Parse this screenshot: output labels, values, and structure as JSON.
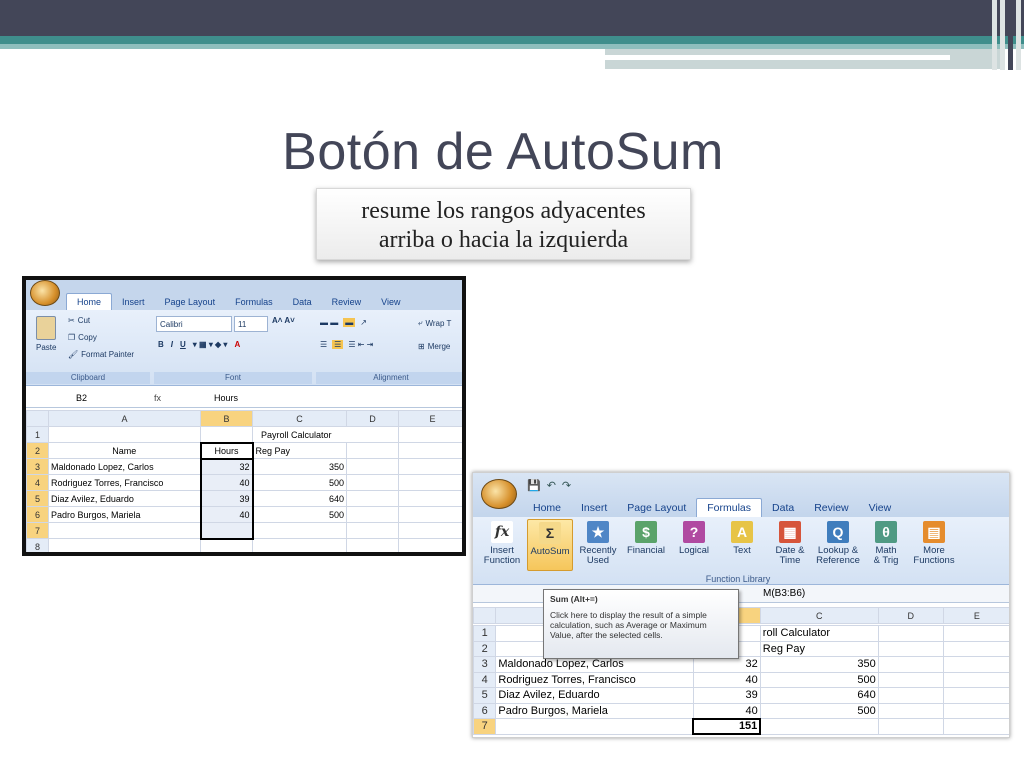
{
  "slide": {
    "title": "Botón de AutoSum",
    "subtitle_line1": "resume los rangos adyacentes",
    "subtitle_line2": "arriba o hacia la izquierda"
  },
  "shot1": {
    "tabs": [
      "Home",
      "Insert",
      "Page Layout",
      "Formulas",
      "Data",
      "Review",
      "View"
    ],
    "clipboard": {
      "paste": "Paste",
      "cut": "Cut",
      "copy": "Copy",
      "format_painter": "Format Painter",
      "group": "Clipboard"
    },
    "font": {
      "name": "Calibri",
      "size": "11",
      "group": "Font"
    },
    "alignment": {
      "wrap": "Wrap T",
      "merge": "Merge",
      "group": "Alignment"
    },
    "name_box": "B2",
    "fx": "fx",
    "formula": "Hours",
    "columns": [
      "A",
      "B",
      "C",
      "D",
      "E"
    ],
    "rows": [
      {
        "n": "1",
        "a": "",
        "b": "",
        "c": "Payroll Calculator"
      },
      {
        "n": "2",
        "a": "Name",
        "b": "Hours",
        "c": "Reg Pay"
      },
      {
        "n": "3",
        "a": "Maldonado Lopez, Carlos",
        "b": "32",
        "c": "350"
      },
      {
        "n": "4",
        "a": "Rodriguez Torres, Francisco",
        "b": "40",
        "c": "500"
      },
      {
        "n": "5",
        "a": "Diaz Avilez, Eduardo",
        "b": "39",
        "c": "640"
      },
      {
        "n": "6",
        "a": "Padro Burgos, Mariela",
        "b": "40",
        "c": "500"
      },
      {
        "n": "7",
        "a": "",
        "b": "",
        "c": ""
      },
      {
        "n": "8",
        "a": "",
        "b": "",
        "c": ""
      }
    ]
  },
  "shot2": {
    "tabs": [
      "Home",
      "Insert",
      "Page Layout",
      "Formulas",
      "Data",
      "Review",
      "View"
    ],
    "buttons": [
      {
        "l1": "Insert",
        "l2": "Function",
        "icon": "fx"
      },
      {
        "l1": "AutoSum",
        "l2": "",
        "icon": "Σ"
      },
      {
        "l1": "Recently",
        "l2": "Used",
        "icon": "★"
      },
      {
        "l1": "Financial",
        "l2": "",
        "icon": "$"
      },
      {
        "l1": "Logical",
        "l2": "",
        "icon": "?"
      },
      {
        "l1": "Text",
        "l2": "",
        "icon": "A"
      },
      {
        "l1": "Date &",
        "l2": "Time",
        "icon": "▦"
      },
      {
        "l1": "Lookup &",
        "l2": "Reference",
        "icon": "Q"
      },
      {
        "l1": "Math",
        "l2": "& Trig",
        "icon": "θ"
      },
      {
        "l1": "More",
        "l2": "Functions",
        "icon": "▤"
      }
    ],
    "group": "Function Library",
    "formula_fragment": "M(B3:B6)",
    "tooltip": {
      "title": "Sum (Alt+=)",
      "body": "Click here to display the result of a simple calculation, such as Average or Maximum Value, after the selected cells."
    },
    "columns": [
      "C",
      "D",
      "E"
    ],
    "rows": [
      {
        "n": "1",
        "a": "",
        "b": "",
        "c": "roll Calculator"
      },
      {
        "n": "2",
        "a": "",
        "b": "",
        "c": "Reg Pay"
      },
      {
        "n": "3",
        "a": "Maldonado Lopez, Carlos",
        "b": "32",
        "c": "350"
      },
      {
        "n": "4",
        "a": "Rodriguez Torres, Francisco",
        "b": "40",
        "c": "500"
      },
      {
        "n": "5",
        "a": "Diaz Avilez, Eduardo",
        "b": "39",
        "c": "640"
      },
      {
        "n": "6",
        "a": "Padro Burgos, Mariela",
        "b": "40",
        "c": "500"
      },
      {
        "n": "7",
        "a": "",
        "b": "151",
        "c": ""
      }
    ]
  },
  "colors": {
    "slate": "#434658",
    "teal": "#3f8e8c",
    "ribbon_blue": "#c5d6ec",
    "selected_header": "#f8d37f"
  }
}
